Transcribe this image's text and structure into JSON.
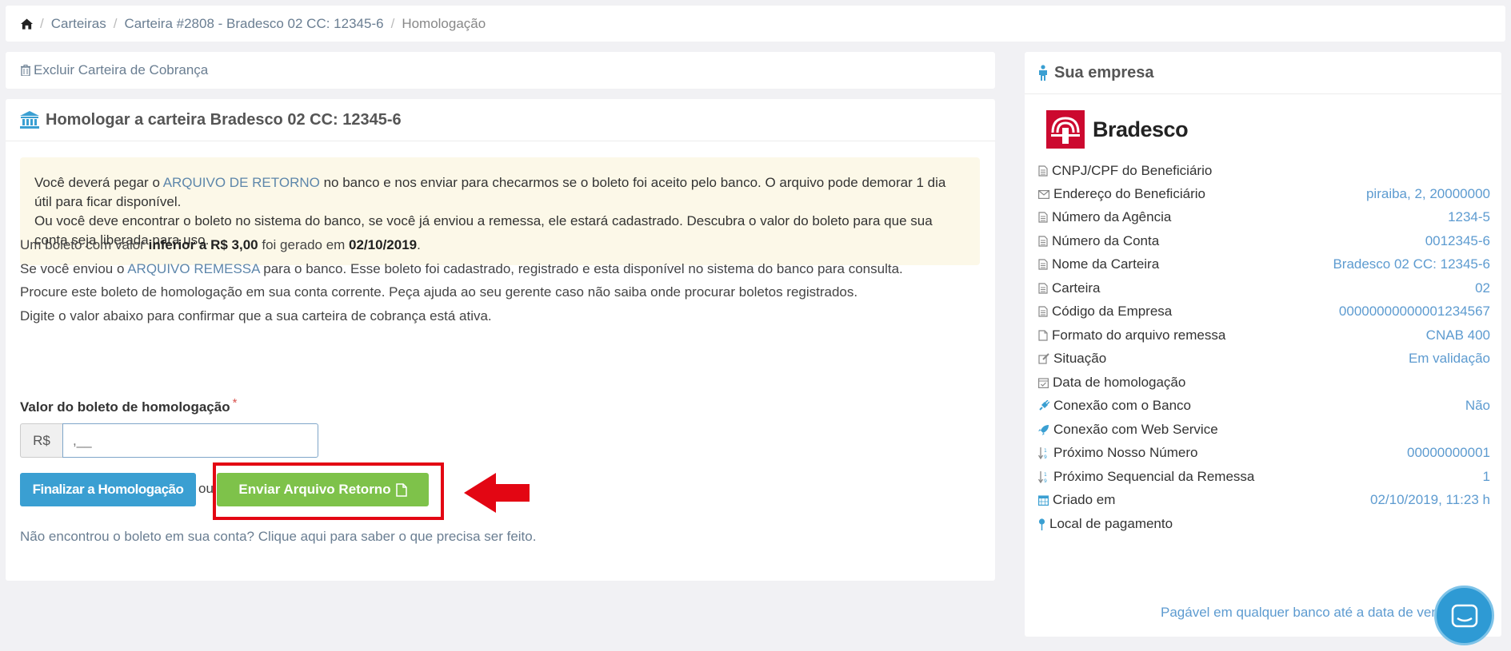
{
  "breadcrumb": {
    "items": [
      "Carteiras",
      "Carteira #2808 - Bradesco 02 CC: 12345-6",
      "Homologação"
    ],
    "separator": "/"
  },
  "delete_card": {
    "label": "Excluir Carteira de Cobrança"
  },
  "main": {
    "title": "Homologar a carteira Bradesco 02 CC: 12345-6",
    "alert": {
      "p1_pre": "Você deverá pegar o ",
      "p1_hl": "ARQUIVO DE RETORNO",
      "p1_post": " no banco e nos enviar para checarmos se o boleto foi aceito pelo banco. O arquivo pode demorar 1 dia útil para ficar disponível.",
      "p2": "Ou você deve encontrar o boleto no sistema do banco, se você já enviou a remessa, ele estará cadastrado. Descubra o valor do boleto para que sua conta seja liberada para uso."
    },
    "para1": {
      "pre": "Um boleto com valor ",
      "bold1": "inferior a R$ 3,00",
      "mid": " foi gerado em ",
      "bold2": "02/10/2019",
      "post": "."
    },
    "para2": {
      "pre": "Se você enviou o ",
      "hl": "ARQUIVO REMESSA",
      "post": " para o banco. Esse boleto foi cadastrado, registrado e esta disponível no sistema do banco para consulta."
    },
    "para3": "Procure este boleto de homologação em sua conta corrente. Peça ajuda ao seu gerente caso não saiba onde procurar boletos registrados.",
    "para4": "Digite o valor abaixo para confirmar que a sua carteira de cobrança está ativa.",
    "field_label": "Valor do boleto de homologação",
    "required_mark": "*",
    "currency_addon": "R$",
    "input_value": "",
    "input_placeholder": ",__",
    "finalize_label": "Finalizar a Homologação",
    "or_text": "ou",
    "send_label": "Enviar Arquivo Retorno",
    "help_link": "Não encontrou o boleto em sua conta? Clique aqui para saber o que precisa ser feito."
  },
  "company": {
    "title": "Sua empresa",
    "bank_name": "Bradesco",
    "rows": [
      {
        "label": "CNPJ/CPF do Beneficiário",
        "value": "",
        "icon": "file-icon"
      },
      {
        "label": "Endereço do Beneficiário",
        "value": "piraiba, 2, 20000000",
        "icon": "envelope-icon"
      },
      {
        "label": "Número da Agência",
        "value": "1234-5",
        "icon": "file-icon"
      },
      {
        "label": "Número da Conta",
        "value": "0012345-6",
        "icon": "file-icon"
      },
      {
        "label": "Nome da Carteira",
        "value": "Bradesco 02 CC: 12345-6",
        "icon": "file-icon"
      },
      {
        "label": "Carteira",
        "value": "02",
        "icon": "file-icon"
      },
      {
        "label": "Código da Empresa",
        "value": "00000000000001234567",
        "icon": "file-icon"
      },
      {
        "label": "Formato do arquivo remessa",
        "value": "CNAB 400",
        "icon": "file-outline-icon"
      },
      {
        "label": "Situação",
        "value": "Em validação",
        "icon": "edit-icon"
      },
      {
        "label": "Data de homologação",
        "value": "",
        "icon": "calendar-check-icon"
      },
      {
        "label": "Conexão com o Banco",
        "value": "Não",
        "icon": "plug-icon"
      },
      {
        "label": "Conexão com Web Service",
        "value": "",
        "icon": "rocket-icon"
      },
      {
        "label": "Próximo Nosso Número",
        "value": "00000000001",
        "icon": "sort-numeric-icon"
      },
      {
        "label": "Próximo Sequencial da Remessa",
        "value": "1",
        "icon": "sort-numeric-icon"
      },
      {
        "label": "Criado em",
        "value": "02/10/2019, 11:23 h",
        "icon": "calendar-icon"
      },
      {
        "label": "Local de pagamento",
        "value": "",
        "icon": "map-pin-icon"
      }
    ],
    "local_value": "Pagável em qualquer banco até a data de ven"
  },
  "colors": {
    "primary": "#3a9fd2",
    "success": "#7ec24a",
    "highlight": "#e30613",
    "link": "#5d9bd0"
  }
}
